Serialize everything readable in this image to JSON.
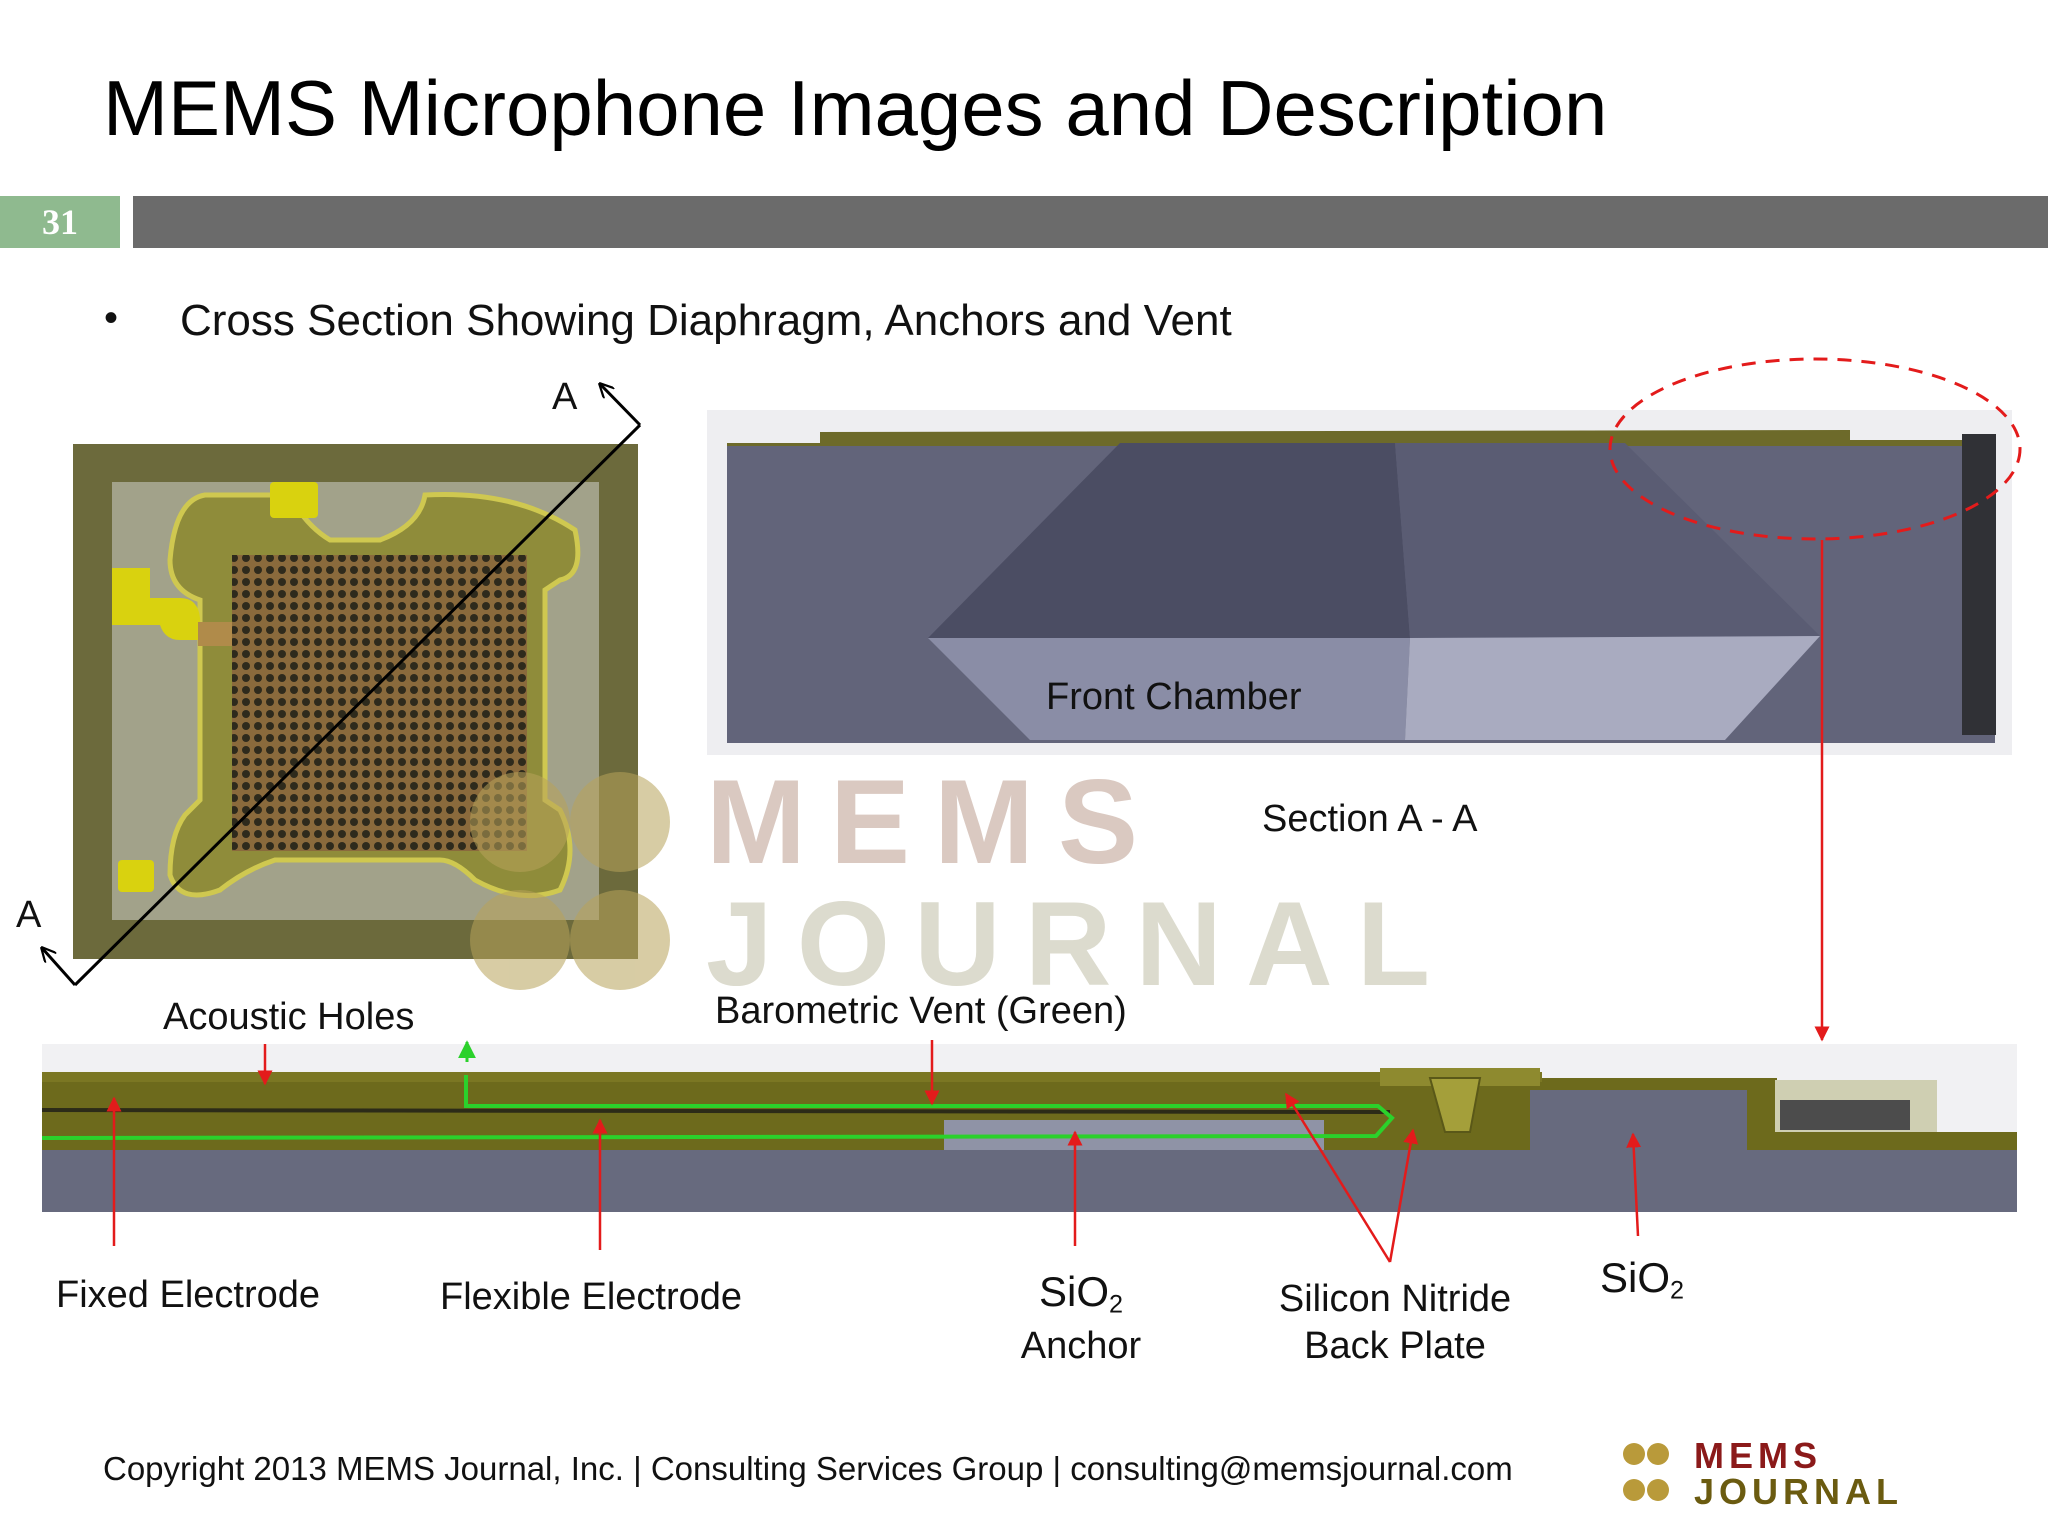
{
  "title": "MEMS Microphone Images and Description",
  "slide_number": "31",
  "bullet": "Cross Section Showing Diaphragm, Anchors and Vent",
  "section_markers": {
    "top": "A",
    "bottom": "A"
  },
  "labels": {
    "front_chamber": "Front Chamber",
    "section": "Section A - A",
    "acoustic_holes": "Acoustic Holes",
    "barometric_vent": "Barometric Vent (Green)",
    "fixed_electrode": "Fixed Electrode",
    "flexible_electrode": "Flexible Electrode",
    "sio2_anchor": {
      "main": "SiO",
      "sub": "2",
      "line2": "Anchor"
    },
    "silicon_nitride": {
      "line1": "Silicon Nitride",
      "line2": "Back Plate"
    },
    "sio2": {
      "main": "SiO",
      "sub": "2"
    }
  },
  "watermark": {
    "line1": "MEMS",
    "line2": "JOURNAL"
  },
  "footer": "Copyright 2013 MEMS Journal, Inc. | Consulting Services Group | consulting@memsjournal.com",
  "logo": {
    "line1": "MEMS",
    "line2": "JOURNAL"
  },
  "colors": {
    "slide_number_bg": "#8fba8f",
    "title_bar": "#6b6b6b",
    "callout_red": "#e31b1b",
    "vent_green": "#2bd12b",
    "layer_gold": "#6d6a1c",
    "substrate": "#676a7e"
  }
}
